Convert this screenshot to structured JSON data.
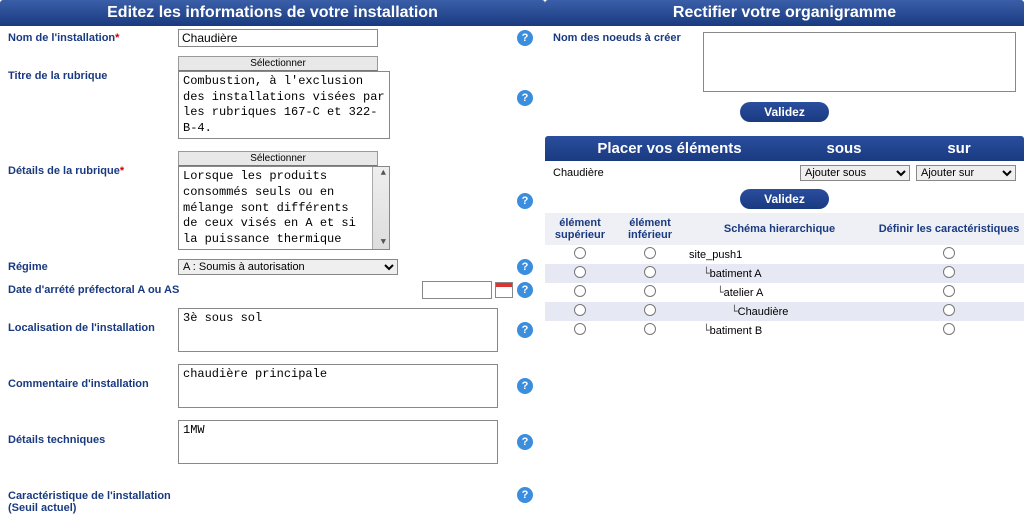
{
  "left": {
    "title": "Editez les informations de votre installation",
    "rows": {
      "nom": {
        "label": "Nom de l'installation",
        "required": true,
        "value": "Chaudière"
      },
      "titre": {
        "label": "Titre de la rubrique",
        "select_btn": "Sélectionner",
        "value": "Combustion, à l'exclusion des installations visées par les rubriques 167-C et 322-B-4."
      },
      "details": {
        "label": "Détails de la rubrique",
        "required": true,
        "select_btn": "Sélectionner",
        "value": "Lorsque les produits consommés seuls ou en mélange sont différents de ceux visés en A et si la puissance thermique"
      },
      "regime": {
        "label": "Régime",
        "value": "A : Soumis à autorisation"
      },
      "date": {
        "label": "Date d'arrété préfectoral A ou AS",
        "value": ""
      },
      "localisation": {
        "label": "Localisation de l'installation",
        "value": "3è sous sol"
      },
      "commentaire": {
        "label": "Commentaire d'installation",
        "value": "chaudière principale"
      },
      "techniques": {
        "label": "Détails techniques",
        "value": "1MW"
      },
      "caract": {
        "label": "Caractéristique de l'installation (Seuil actuel)",
        "value": ""
      }
    }
  },
  "right": {
    "org_title": "Rectifier votre organigramme",
    "noeuds_label": "Nom des noeuds à créer",
    "validez": "Validez",
    "placer": {
      "title": "Placer vos éléments",
      "col_sous": "sous",
      "col_sur": "sur",
      "element_name": "Chaudière",
      "sel_sous": "Ajouter sous",
      "sel_sur": "Ajouter sur"
    },
    "tree_headers": {
      "sup": "élément supérieur",
      "inf": "élément inférieur",
      "schema": "Schéma hierarchique",
      "definir": "Définir les caractéristiques"
    },
    "tree": [
      {
        "label": "site_push1",
        "depth": 0
      },
      {
        "label": "batiment A",
        "depth": 1
      },
      {
        "label": "atelier A",
        "depth": 2
      },
      {
        "label": "Chaudière",
        "depth": 3
      },
      {
        "label": "batiment B",
        "depth": 1
      }
    ]
  }
}
